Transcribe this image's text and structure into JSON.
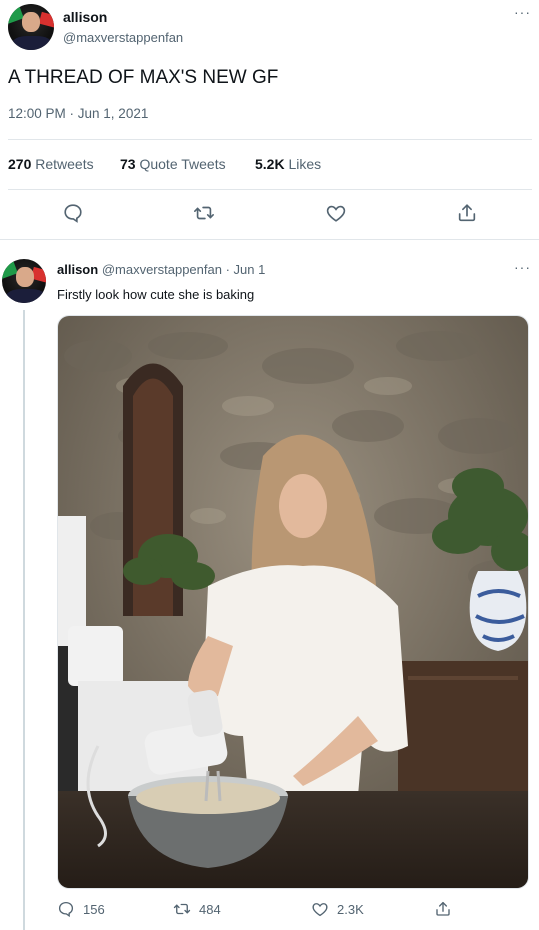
{
  "main_tweet": {
    "display_name": "allison",
    "handle": "@maxverstappenfan",
    "text": "A THREAD OF MAX'S NEW GF",
    "timestamp": "12:00 PM · Jun 1, 2021",
    "stats": {
      "retweets_count": "270",
      "retweets_label": "Retweets",
      "quotes_count": "73",
      "quotes_label": "Quote Tweets",
      "likes_count": "5.2K",
      "likes_label": "Likes"
    },
    "more_glyph": "···"
  },
  "reply_tweet": {
    "display_name": "allison",
    "handle_date": "@maxverstappenfan · Jun 1",
    "text": "Firstly look how cute she is baking",
    "more_glyph": "···",
    "counts": {
      "replies": "156",
      "retweets": "484",
      "likes": "2.3K"
    }
  },
  "icons": [
    "reply-icon",
    "retweet-icon",
    "like-icon",
    "share-icon"
  ],
  "colors": {
    "text": "#0f1419",
    "muted": "#536471",
    "divider": "#e1e6ea",
    "photo_stone": "#8a8070"
  }
}
